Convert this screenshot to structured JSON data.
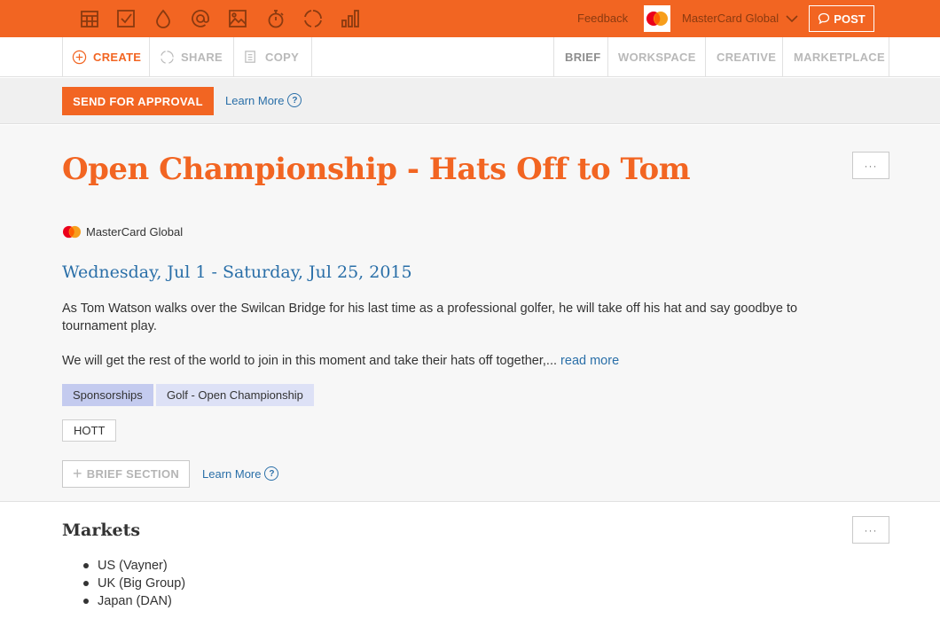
{
  "topbar": {
    "icons": [
      "calendar-icon",
      "checklist-icon",
      "drop-icon",
      "at-icon",
      "image-icon",
      "stopwatch-icon",
      "loading-icon",
      "bar-chart-icon"
    ],
    "feedback": "Feedback",
    "brand": "MasterCard Global",
    "post_label": "POST"
  },
  "toolbar": {
    "create": "CREATE",
    "share": "SHARE",
    "copy": "COPY",
    "tabs": [
      "BRIEF",
      "WORKSPACE",
      "CREATIVE",
      "MARKETPLACE"
    ],
    "active_tab": "BRIEF"
  },
  "actionbar": {
    "approve": "SEND FOR APPROVAL",
    "learn_more": "Learn More"
  },
  "brief": {
    "more": "···",
    "title": "Open Championship - Hats Off to Tom",
    "client": "MasterCard Global",
    "dates": "Wednesday, Jul 1 - Saturday, Jul 25, 2015",
    "paragraph1": "As Tom Watson walks over the Swilcan Bridge for his last time as a professional golfer, he will take off his hat and say goodbye to tournament play.",
    "paragraph2": "We will get the rest of the world to join in this moment and take their hats off together,...",
    "read_more": "read more",
    "tags": [
      "Sponsorships",
      "Golf - Open Championship"
    ],
    "keyword": "HOTT",
    "add_section": "BRIEF SECTION",
    "learn_more": "Learn More"
  },
  "markets": {
    "title": "Markets",
    "more": "···",
    "items": [
      "US (Vayner)",
      "UK (Big Group)",
      "Japan (DAN)"
    ]
  },
  "colors": {
    "accent": "#f26522",
    "link": "#2a6fa8",
    "tag_primary": "#c4cbef",
    "tag_secondary": "#dde1f6"
  }
}
